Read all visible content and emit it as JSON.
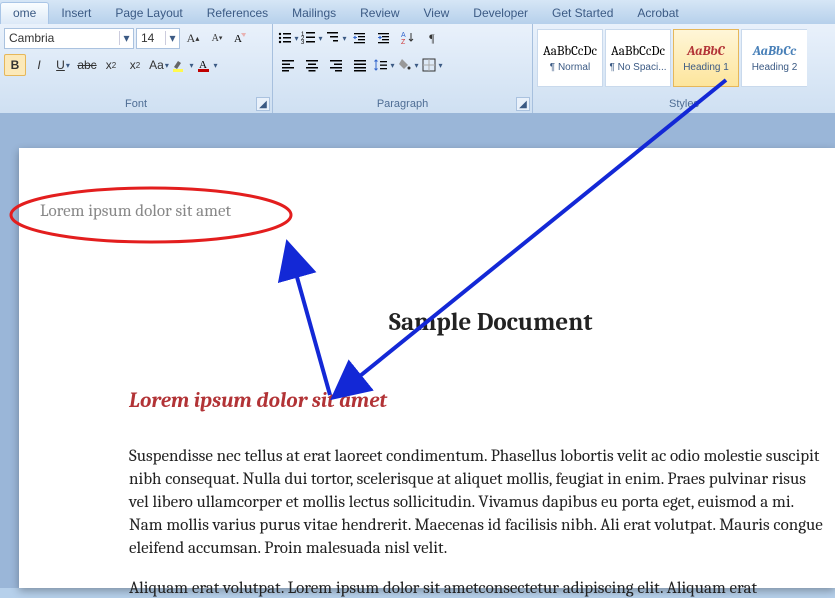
{
  "tabs": {
    "home": "ome",
    "insert": "Insert",
    "page_layout": "Page Layout",
    "references": "References",
    "mailings": "Mailings",
    "review": "Review",
    "view": "View",
    "developer": "Developer",
    "get_started": "Get Started",
    "acrobat": "Acrobat"
  },
  "font": {
    "group_label": "Font",
    "name": "Cambria",
    "size": "14"
  },
  "paragraph": {
    "group_label": "Paragraph"
  },
  "styles": {
    "group_label": "Styles",
    "items": [
      {
        "sample": "AaBbCcDc",
        "name": "¶ Normal"
      },
      {
        "sample": "AaBbCcDc",
        "name": "¶ No Spaci..."
      },
      {
        "sample": "AaBbC",
        "name": "Heading 1"
      },
      {
        "sample": "AaBbCc",
        "name": "Heading 2"
      }
    ]
  },
  "doc": {
    "nav_text": "Lorem ipsum dolor sit amet",
    "title": "Sample Document",
    "h1": "Lorem ipsum dolor sit amet",
    "body": "Suspendisse nec tellus at erat laoreet condimentum. Phasellus lobortis velit ac odio molestie suscipit nibh consequat. Nulla dui tortor, scelerisque at aliquet mollis, feugiat in enim. Praes pulvinar risus vel libero ullamcorper et mollis lectus sollicitudin. Vivamus dapibus eu porta eget, euismod a mi. Nam mollis varius purus vitae hendrerit. Maecenas id facilisis nibh. Ali erat volutpat. Mauris congue eleifend accumsan. Proin malesuada nisl velit.",
    "body2": "Aliquam erat volutpat. Lorem ipsum dolor sit ametconsectetur adipiscing elit. Aliquam erat"
  }
}
